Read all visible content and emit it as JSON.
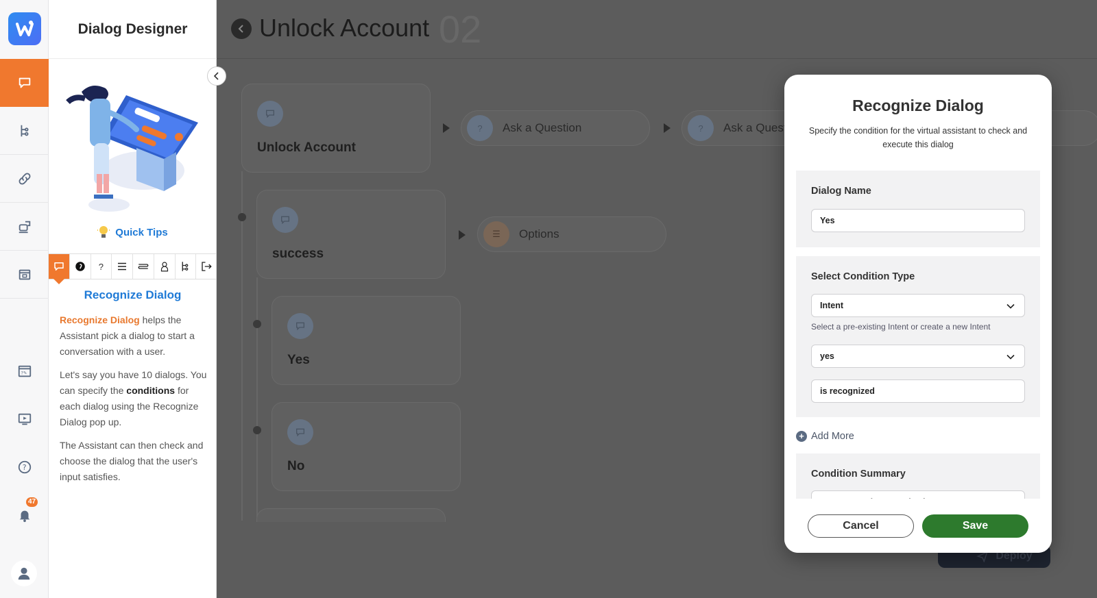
{
  "app": {
    "panel_title": "Dialog Designer"
  },
  "rail": {
    "notification_count": "47",
    "icons": [
      "chat-icon",
      "tree-icon",
      "link-icon",
      "chatbot-icon",
      "build-icon",
      "faq-icon",
      "media-icon",
      "help-icon",
      "bell-icon",
      "user-icon"
    ]
  },
  "tips": {
    "quick_tips_label": "Quick Tips",
    "heading": "Recognize Dialog",
    "para1_highlight": "Recognize Dialog",
    "para1_rest": " helps the Assistant pick a dialog to start a conversation with a user.",
    "para2_before": "Let's say you have 10 dialogs. You can specify the ",
    "para2_bold": "conditions",
    "para2_after": " for each dialog using the Recognize Dialog pop up.",
    "para3": "The Assistant can then check and choose the dialog that the user's input satisfies.",
    "tabs": [
      "recognize-dialog",
      "ai-script",
      "question",
      "options",
      "flow",
      "human-agent",
      "branch",
      "exit"
    ],
    "tab_question_glyph": "?"
  },
  "canvas": {
    "title": "Unlock Account",
    "ghost_number": "02",
    "nodes": [
      {
        "label": "Unlock Account"
      },
      {
        "label": "success"
      },
      {
        "label": "Yes"
      },
      {
        "label": "No"
      }
    ],
    "pills": [
      {
        "label": "Ask a Question",
        "icon_glyph": "?"
      },
      {
        "label": "Ask a Quest",
        "icon_glyph": "?"
      },
      {
        "label": "Options",
        "icon_glyph": "☰"
      }
    ],
    "deploy_label": "Deploy"
  },
  "modal": {
    "title": "Recognize Dialog",
    "subtitle": "Specify the condition for the virtual assistant to check and execute this dialog",
    "dialog_name_label": "Dialog Name",
    "dialog_name_value": "Yes",
    "condition_type_label": "Select Condition Type",
    "condition_type_value": "Intent",
    "condition_type_hint": "Select a pre-existing Intent or create a new Intent",
    "intent_value": "yes",
    "recognized_value": "is recognized",
    "add_more_label": "Add More",
    "summary_label": "Condition Summary",
    "summary_value": "Intent \"yes\" is recognized",
    "cancel_label": "Cancel",
    "save_label": "Save"
  },
  "colors": {
    "accent": "#f0782e",
    "link": "#1f7ad6",
    "save": "#2d7a2d",
    "overlay": "#5c5c5c"
  }
}
